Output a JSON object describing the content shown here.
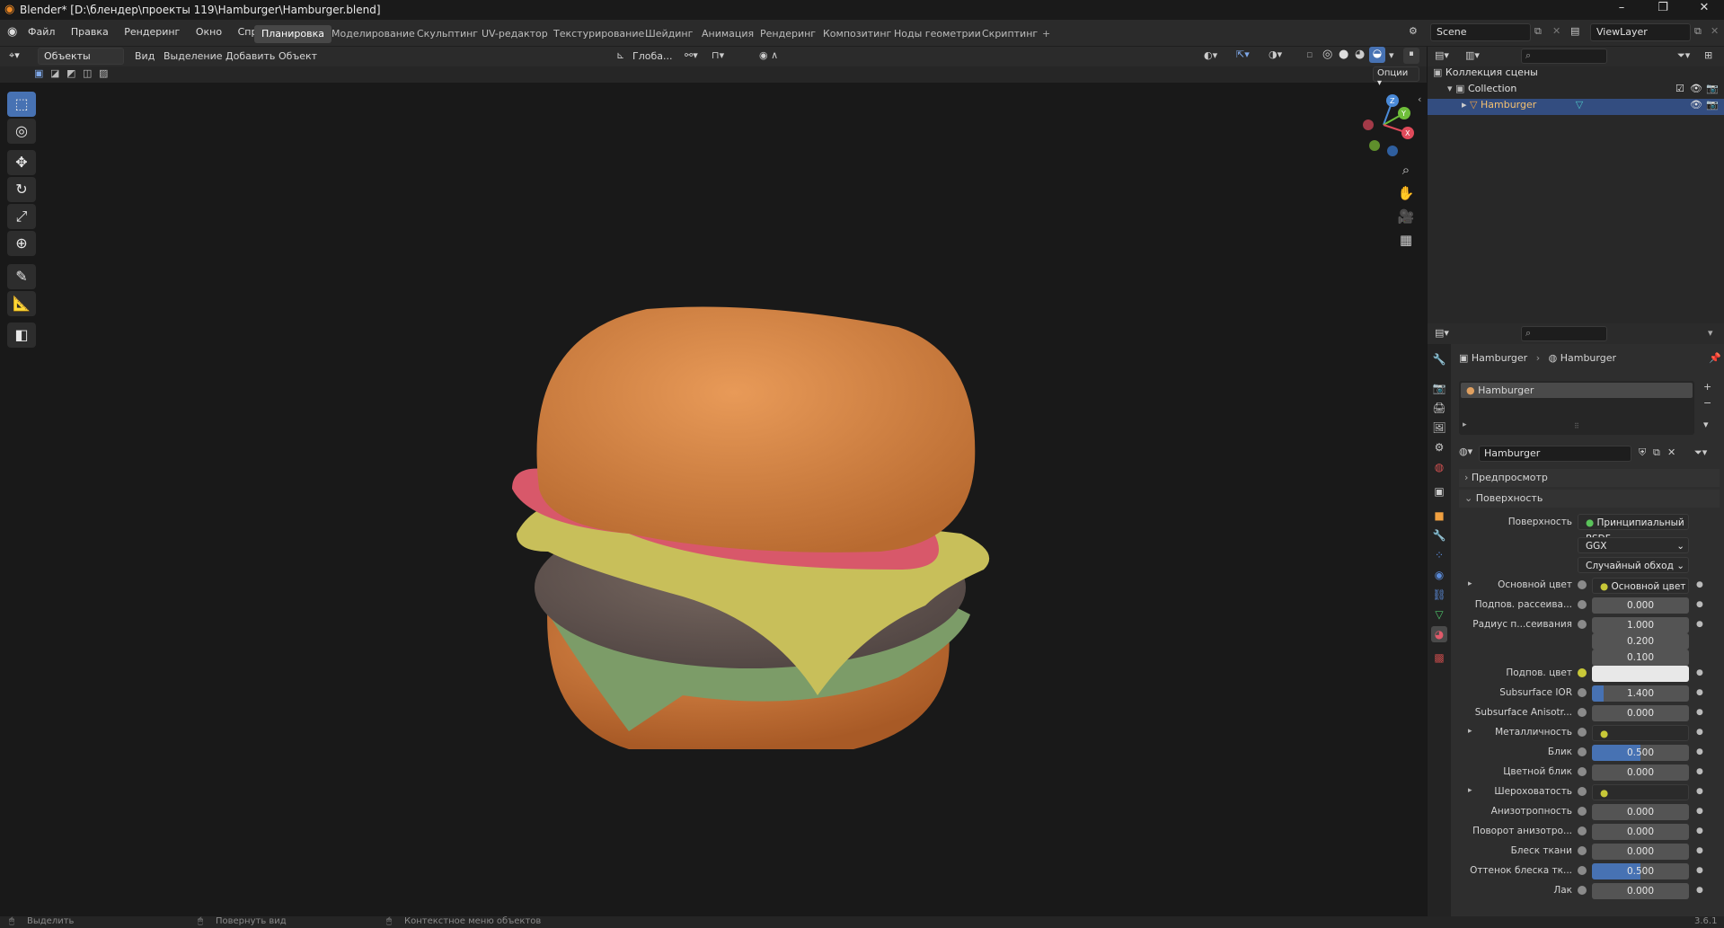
{
  "window": {
    "title": "Blender* [D:\\блендер\\проекты 119\\Hamburger\\Hamburger.blend]",
    "minimize": "–",
    "maximize": "❐",
    "close": "✕"
  },
  "menu": [
    "Файл",
    "Правка",
    "Рендеринг",
    "Окно",
    "Справка"
  ],
  "workspaces": [
    "Планировка",
    "Моделирование",
    "Скульптинг",
    "UV-редактор",
    "Текстурирование",
    "Шейдинг",
    "Анимация",
    "Рендеринг",
    "Композитинг",
    "Ноды геометрии",
    "Скриптинг"
  ],
  "workspace_add": "+",
  "scene": {
    "name": "Scene",
    "view_layer": "ViewLayer"
  },
  "viewport_header": {
    "mode": "Объекты",
    "menus": [
      "Вид",
      "Выделение",
      "Добавить",
      "Объект"
    ],
    "orientation": "Глоба...",
    "options": "Опции"
  },
  "outliner": {
    "scene_collection": "Коллекция сцены",
    "collection": "Collection",
    "object": "Hamburger"
  },
  "properties": {
    "breadcrumb_object": "Hamburger",
    "breadcrumb_material": "Hamburger",
    "slot_name": "Hamburger",
    "material_name": "Hamburger",
    "preview_label": "Предпросмотр",
    "surface_section": "Поверхность",
    "surface_label": "Поверхность",
    "surface_value": "Принципиальный BSDF",
    "distribution": "GGX",
    "subsurface_method": "Случайный обход",
    "rows": [
      {
        "label": "Основной цвет",
        "value": "Основной цвет",
        "kind": "link"
      },
      {
        "label": "Подпов. рассеива...",
        "value": "0.000",
        "kind": "num"
      },
      {
        "label": "Радиус п...сеивания",
        "value": "1.000",
        "kind": "num"
      },
      {
        "label": "",
        "value": "0.200",
        "kind": "num"
      },
      {
        "label": "",
        "value": "0.100",
        "kind": "num"
      },
      {
        "label": "Подпов. цвет",
        "value": "",
        "kind": "color"
      },
      {
        "label": "Subsurface IOR",
        "value": "1.400",
        "kind": "ior"
      },
      {
        "label": "Subsurface Anisotr...",
        "value": "0.000",
        "kind": "num"
      },
      {
        "label": "Металличность",
        "value": "Металличность",
        "kind": "link"
      },
      {
        "label": "Блик",
        "value": "0.500",
        "kind": "blue"
      },
      {
        "label": "Цветной блик",
        "value": "0.000",
        "kind": "num"
      },
      {
        "label": "Шероховатость",
        "value": "Шероховатость",
        "kind": "link"
      },
      {
        "label": "Анизотропность",
        "value": "0.000",
        "kind": "num"
      },
      {
        "label": "Поворот анизотро...",
        "value": "0.000",
        "kind": "num"
      },
      {
        "label": "Блеск ткани",
        "value": "0.000",
        "kind": "num"
      },
      {
        "label": "Оттенок блеска тк...",
        "value": "0.500",
        "kind": "blue"
      },
      {
        "label": "Лак",
        "value": "0.000",
        "kind": "num"
      }
    ]
  },
  "statusbar": {
    "select": "Выделить",
    "rotate": "Повернуть вид",
    "context": "Контекстное меню объектов",
    "version": "3.6.1"
  },
  "gizmo": {
    "z": "Z",
    "y": "Y",
    "x": "X"
  }
}
